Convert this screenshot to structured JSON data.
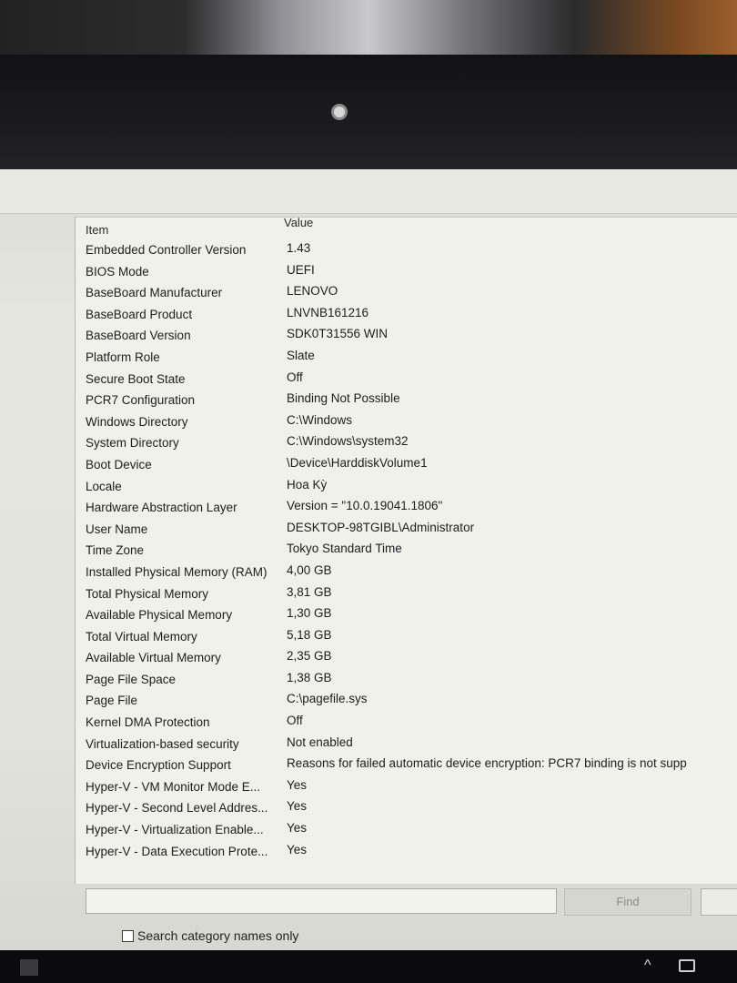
{
  "header": {
    "item_label": "Item",
    "value_label": "Value"
  },
  "rows": [
    {
      "item": "Embedded Controller Version",
      "value": "1.43"
    },
    {
      "item": "BIOS Mode",
      "value": "UEFI"
    },
    {
      "item": "BaseBoard Manufacturer",
      "value": "LENOVO"
    },
    {
      "item": "BaseBoard Product",
      "value": "LNVNB161216"
    },
    {
      "item": "BaseBoard Version",
      "value": "SDK0T31556 WIN"
    },
    {
      "item": "Platform Role",
      "value": "Slate"
    },
    {
      "item": "Secure Boot State",
      "value": "Off"
    },
    {
      "item": "PCR7 Configuration",
      "value": "Binding Not Possible"
    },
    {
      "item": "Windows Directory",
      "value": "C:\\Windows"
    },
    {
      "item": "System Directory",
      "value": "C:\\Windows\\system32"
    },
    {
      "item": "Boot Device",
      "value": "\\Device\\HarddiskVolume1"
    },
    {
      "item": "Locale",
      "value": "Hoa Kỳ"
    },
    {
      "item": "Hardware Abstraction Layer",
      "value": "Version = \"10.0.19041.1806\""
    },
    {
      "item": "User Name",
      "value": "DESKTOP-98TGIBL\\Administrator"
    },
    {
      "item": "Time Zone",
      "value": "Tokyo Standard Time"
    },
    {
      "item": "Installed Physical Memory (RAM)",
      "value": "4,00 GB"
    },
    {
      "item": "Total Physical Memory",
      "value": "3,81 GB"
    },
    {
      "item": "Available Physical Memory",
      "value": "1,30 GB"
    },
    {
      "item": "Total Virtual Memory",
      "value": "5,18 GB"
    },
    {
      "item": "Available Virtual Memory",
      "value": "2,35 GB"
    },
    {
      "item": "Page File Space",
      "value": "1,38 GB"
    },
    {
      "item": "Page File",
      "value": "C:\\pagefile.sys"
    },
    {
      "item": "Kernel DMA Protection",
      "value": "Off"
    },
    {
      "item": "Virtualization-based security",
      "value": "Not enabled"
    },
    {
      "item": "Device Encryption Support",
      "value": "Reasons for failed automatic device encryption: PCR7 binding is not supp"
    },
    {
      "item": "Hyper-V - VM Monitor Mode E...",
      "value": "Yes"
    },
    {
      "item": "Hyper-V - Second Level Addres...",
      "value": "Yes"
    },
    {
      "item": "Hyper-V - Virtualization Enable...",
      "value": "Yes"
    },
    {
      "item": "Hyper-V - Data Execution Prote...",
      "value": "Yes"
    }
  ],
  "find": {
    "input_value": "",
    "button_label": "Find"
  },
  "search_category": {
    "label": "Search category names only",
    "checked": false
  }
}
